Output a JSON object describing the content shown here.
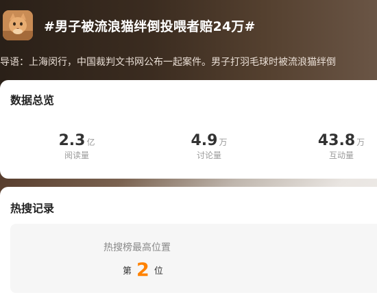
{
  "topic": {
    "title": "#男子被流浪猫绊倒投喂者赔24万#",
    "intro": "导语：上海闵行，中国裁判文书网公布一起案件。男子打羽毛球时被流浪猫绊倒"
  },
  "overview": {
    "title": "数据总览",
    "stats": [
      {
        "value": "2.3",
        "unit": "亿",
        "label": "阅读量"
      },
      {
        "value": "4.9",
        "unit": "万",
        "label": "讨论量"
      },
      {
        "value": "43.8",
        "unit": "万",
        "label": "互动量"
      }
    ]
  },
  "hot_search": {
    "title": "热搜记录",
    "rank_label": "热搜榜最高位置",
    "rank_prefix": "第",
    "rank_value": "2",
    "rank_suffix": "位"
  }
}
